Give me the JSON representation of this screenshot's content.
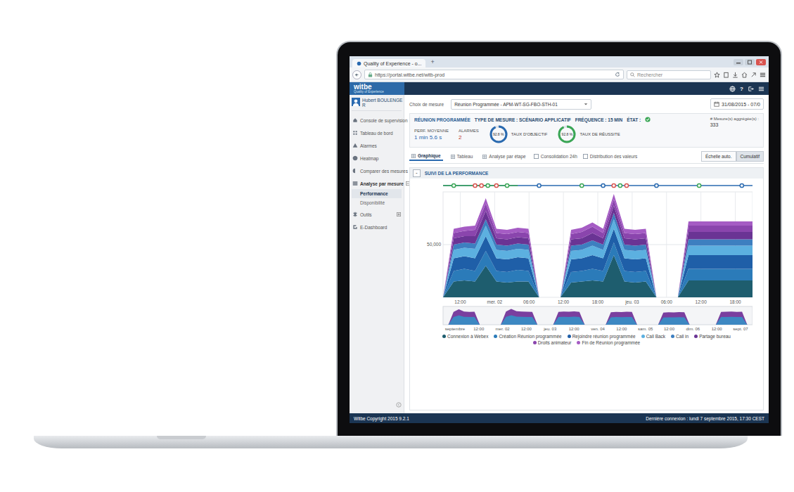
{
  "browser": {
    "tab": "Quality of Experience - o...",
    "newTab": "+",
    "url": "https://portal.witbe.net/witb-prod",
    "search": "Rechercher"
  },
  "app": {
    "logo": "witbe",
    "tagline": "Quality of Experience",
    "help": "?",
    "user": {
      "name": "Hubert BOULENGE",
      "initial": "R"
    }
  },
  "sidebar": {
    "items": [
      {
        "label": "Console de supervision",
        "kind": "link",
        "expanded": false,
        "children": []
      },
      {
        "label": "Tableau de bord",
        "kind": "link",
        "expanded": false,
        "children": []
      },
      {
        "label": "Alarmes",
        "kind": "link",
        "expanded": false,
        "children": []
      },
      {
        "label": "Heatmap",
        "kind": "link",
        "expanded": false,
        "children": []
      },
      {
        "label": "Comparer des mesures",
        "kind": "link",
        "expanded": false,
        "children": []
      },
      {
        "label": "Analyse par mesure",
        "kind": "group",
        "expanded": true,
        "children": [
          {
            "label": "Performance",
            "selected": true
          },
          {
            "label": "Disponibilité",
            "selected": false
          }
        ]
      },
      {
        "label": "Outils",
        "kind": "group",
        "expanded": false,
        "children": []
      },
      {
        "label": "E-Dashboard",
        "kind": "link",
        "expanded": false,
        "children": []
      }
    ]
  },
  "measure": {
    "label": "Choix de mesure",
    "value": "Réunion Programmée - APM-WT-SG-FBO-STH-01",
    "date": "31/08/2015 - 07/0"
  },
  "summary": {
    "title": "RÉUNION PROGRAMMÉE",
    "type": "TYPE DE MESURE : SCÉNARIO APPLICATIF",
    "frequency": "FRÉQUENCE : 15 MIN",
    "stateLabel": "ÉTAT :",
    "stateOk": true,
    "perf": {
      "label": "PERF. MOYENNE",
      "value": "1 min 5.6 s"
    },
    "alarms": {
      "label": "ALARMES",
      "value": "2"
    },
    "gauges": [
      {
        "label": "TAUX D'OBJECTIF",
        "reading": "92.8 %",
        "level": 0.928,
        "color": "#2a6ab0"
      },
      {
        "label": "TAUX DE RÉUSSITE",
        "reading": "92.8 %",
        "level": 0.928,
        "color": "#3aa655"
      }
    ],
    "aggregated": {
      "label": "# Mesure(s) aggrégée(s) :",
      "value": "333"
    }
  },
  "tabs": [
    {
      "label": "Graphique",
      "selected": true
    },
    {
      "label": "Tableau",
      "selected": false
    },
    {
      "label": "Analyse par étape",
      "selected": false
    }
  ],
  "options": [
    {
      "label": "Consolidation 24h",
      "checked": false
    },
    {
      "label": "Distribution des valeurs",
      "checked": false
    }
  ],
  "scaleButtons": [
    {
      "label": "Échelle auto.",
      "selected": false
    },
    {
      "label": "Cumulatif",
      "selected": true
    }
  ],
  "chart": {
    "title": "SUIVI DE LA PERFORMANCE",
    "collapse": "-",
    "yTicks": [
      {
        "value": 50000,
        "label": "50,000"
      }
    ],
    "xTicks": [
      "12:00",
      "mer. 02",
      "06:00",
      "12:00",
      "18:00",
      "jeu. 03",
      "06:00",
      "12:00",
      "18:00"
    ],
    "timeline": [
      {
        "at": 1,
        "color": "#3aa655"
      },
      {
        "at": 3,
        "color": "#d9534f"
      },
      {
        "at": 3.6,
        "color": "#d9534f"
      },
      {
        "at": 4.2,
        "color": "#3aa655"
      },
      {
        "at": 5,
        "color": "#d9534f"
      },
      {
        "at": 6,
        "color": "#3aa655"
      },
      {
        "at": 9,
        "color": "#2a6ab0"
      },
      {
        "at": 13,
        "color": "#3aa655"
      },
      {
        "at": 15,
        "color": "#2a6ab0"
      },
      {
        "at": 16,
        "color": "#d9534f"
      },
      {
        "at": 16.6,
        "color": "#3aa655"
      },
      {
        "at": 17.2,
        "color": "#d9534f"
      },
      {
        "at": 20,
        "color": "#2a6ab0"
      },
      {
        "at": 24,
        "color": "#3aa655"
      },
      {
        "at": 28,
        "color": "#2a6ab0"
      }
    ],
    "series": [
      {
        "name": "Connexion à Webex",
        "color": "#1e5d6e",
        "values": [
          0,
          15000,
          16000,
          15000,
          30000,
          15000,
          14000,
          15000,
          15000,
          0,
          0,
          0,
          14000,
          15000,
          16000,
          15000,
          40000,
          15000,
          14000,
          15000,
          0,
          0,
          0,
          16000,
          16000,
          16000,
          16000,
          16000,
          16000,
          16000
        ]
      },
      {
        "name": "Création Réunion programmée",
        "color": "#2b7bb9",
        "values": [
          0,
          10000,
          11000,
          10000,
          14000,
          10000,
          10000,
          11000,
          10000,
          0,
          0,
          0,
          10000,
          10000,
          11000,
          10000,
          12000,
          10000,
          10000,
          10000,
          0,
          0,
          0,
          11000,
          11000,
          11000,
          11000,
          11000,
          11000,
          11000
        ]
      },
      {
        "name": "Rejoindre réunion programmée",
        "color": "#1f5fa8",
        "values": [
          0,
          12000,
          12000,
          12000,
          14000,
          12000,
          12000,
          12000,
          12000,
          0,
          0,
          0,
          12000,
          12000,
          13000,
          12000,
          13000,
          12000,
          12000,
          12000,
          0,
          0,
          0,
          13000,
          13000,
          13000,
          13000,
          13000,
          13000,
          13000
        ]
      },
      {
        "name": "Call Back",
        "color": "#5cb0e0",
        "values": [
          0,
          8000,
          8000,
          9000,
          10000,
          8000,
          8000,
          8000,
          8000,
          0,
          0,
          0,
          8000,
          8000,
          9000,
          8000,
          9000,
          8000,
          8000,
          8000,
          0,
          0,
          0,
          9000,
          9000,
          9000,
          9000,
          9000,
          9000,
          9000
        ]
      },
      {
        "name": "Call in",
        "color": "#3d7fc0",
        "values": [
          0,
          5000,
          5000,
          5000,
          6000,
          5000,
          5000,
          5000,
          5000,
          0,
          0,
          0,
          5000,
          5000,
          5000,
          5000,
          6000,
          5000,
          5000,
          5000,
          0,
          0,
          0,
          6000,
          6000,
          6000,
          6000,
          6000,
          6000,
          6000
        ]
      },
      {
        "name": "Partage bureau",
        "color": "#6a3494",
        "values": [
          0,
          6000,
          6000,
          7000,
          8000,
          6000,
          6000,
          6000,
          6000,
          0,
          0,
          0,
          6000,
          6000,
          7000,
          6000,
          7000,
          6000,
          6000,
          6000,
          0,
          0,
          0,
          7000,
          7000,
          7000,
          7000,
          7000,
          7000,
          7000
        ]
      },
      {
        "name": "Droits animateur",
        "color": "#8a45ad",
        "values": [
          0,
          5000,
          5000,
          6000,
          7000,
          5000,
          5000,
          5000,
          5000,
          0,
          0,
          0,
          5000,
          6000,
          6000,
          5000,
          6000,
          5000,
          5000,
          5000,
          0,
          0,
          0,
          6000,
          6000,
          6000,
          6000,
          6000,
          6000,
          6000
        ]
      },
      {
        "name": "Fin de Réunion programmée",
        "color": "#a55cc4",
        "values": [
          0,
          4000,
          4000,
          4000,
          5000,
          4000,
          4000,
          4000,
          4000,
          0,
          0,
          0,
          4000,
          4000,
          4000,
          4000,
          5000,
          4000,
          4000,
          4000,
          0,
          0,
          0,
          4000,
          4000,
          4000,
          4000,
          4000,
          4000,
          4000
        ]
      }
    ],
    "navigator": {
      "totals": [
        0,
        0,
        70000,
        85000,
        72000,
        70000,
        71000,
        0,
        0,
        0,
        0,
        0,
        72000,
        86000,
        74000,
        72000,
        71000,
        70000,
        0,
        0,
        0,
        0,
        70000,
        72000,
        71000,
        73000,
        70000,
        0,
        0,
        0,
        0,
        0,
        68000,
        70000,
        69000,
        71000,
        70000,
        0,
        0,
        0,
        0,
        0,
        66000,
        68000,
        67000,
        69000,
        68000,
        0,
        0,
        0,
        0,
        0,
        0,
        70000,
        71000,
        72000,
        70000,
        71000,
        0,
        0
      ],
      "labels": [
        "septembre",
        "12:00",
        "mer. 02",
        "12:00",
        "jeu. 03",
        "12:00",
        "ven. 04",
        "12:00",
        "sam. 05",
        "12:00",
        "dim. 06",
        "12:00",
        "sept. 07"
      ]
    }
  },
  "footer": {
    "copyright": "Witbe Copyright 2015 9.2.1",
    "lastLogin": "Dernière connexion : lundi 7 septembre 2015, 17:30 CEST"
  }
}
